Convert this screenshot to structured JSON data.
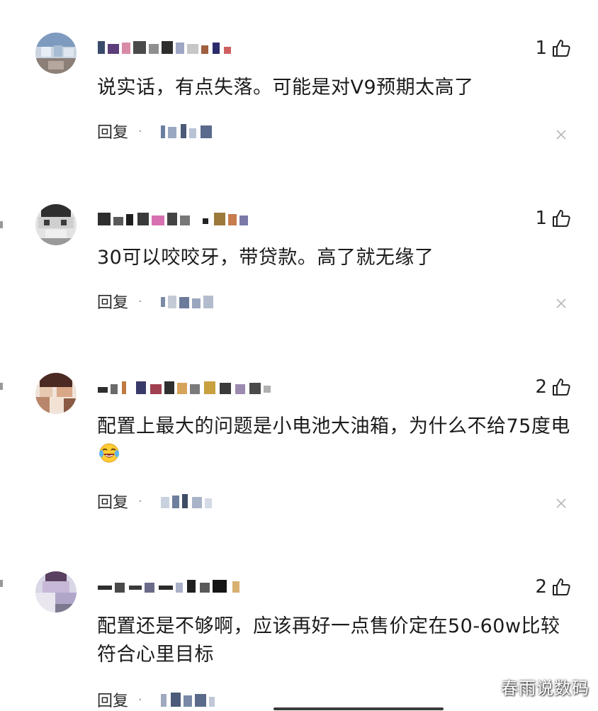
{
  "comments": [
    {
      "likes": "1",
      "text": "说实话，有点失落。可能是对V9预期太高了",
      "reply_label": "回复",
      "dot": "·"
    },
    {
      "likes": "1",
      "text": "30可以咬咬牙，带贷款。高了就无缘了",
      "reply_label": "回复",
      "dot": "·"
    },
    {
      "likes": "2",
      "text": "配置上最大的问题是小电池大油箱，为什么不给75度电",
      "reply_label": "回复",
      "dot": "·"
    },
    {
      "likes": "2",
      "text": "配置还是不够啊，应该再好一点售价定在50-60w比较符合心里目标",
      "reply_label": "回复",
      "dot": "·"
    }
  ],
  "watermark": "春雨说数码",
  "icons": {
    "like": "thumbs-up-icon",
    "close": "close-icon",
    "emoji": "laughing-tears-emoji"
  }
}
